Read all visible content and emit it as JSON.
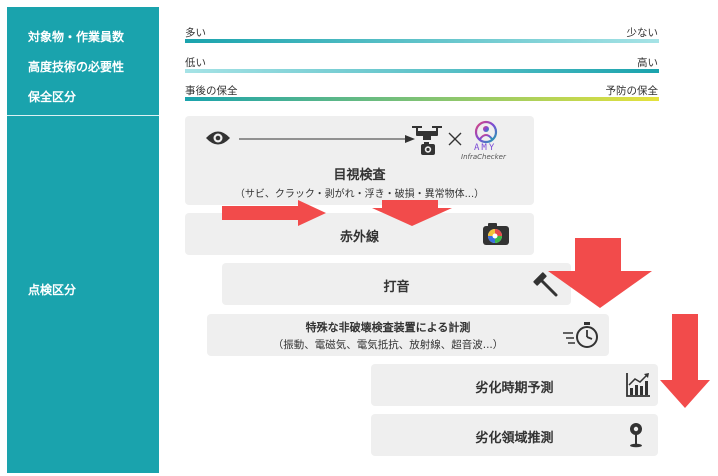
{
  "sidebar": {
    "target_count_label": "対象物・作業員数",
    "skill_label": "高度技術の必要性",
    "maintenance_label": "保全区分",
    "inspection_label": "点検区分"
  },
  "scales": [
    {
      "left": "多い",
      "right": "少ない"
    },
    {
      "left": "低い",
      "right": "高い"
    },
    {
      "left": "事後の保全",
      "right": "予防の保全"
    }
  ],
  "colors": {
    "teal": "#1aa3ad",
    "panel": "#efefef",
    "arrow": "#f24b4b",
    "yellow": "#e5e23c"
  },
  "panels": {
    "visual": {
      "title": "目視検査",
      "subtitle": "（サビ、クラック・剥がれ・浮き・破損・異常物体...）",
      "icons": [
        "eye-icon",
        "drone-icon",
        "camera-icon"
      ]
    },
    "logo": {
      "brand": "AMY",
      "sub": "InfraChecker"
    },
    "infrared": {
      "title": "赤外線",
      "icon": "color-camera-icon"
    },
    "hammer": {
      "title": "打音",
      "icon": "hammer-icon"
    },
    "nondestructive": {
      "title": "特殊な非破壊検査装置による計測",
      "subtitle": "（振動、電磁気、電気抵抗、放射線、超音波...）",
      "icon": "stopwatch-icon"
    },
    "deterioration": {
      "title": "劣化時期予測",
      "icon": "chart-icon"
    },
    "area": {
      "title": "劣化領域推測",
      "icon": "map-pin-icon"
    }
  }
}
